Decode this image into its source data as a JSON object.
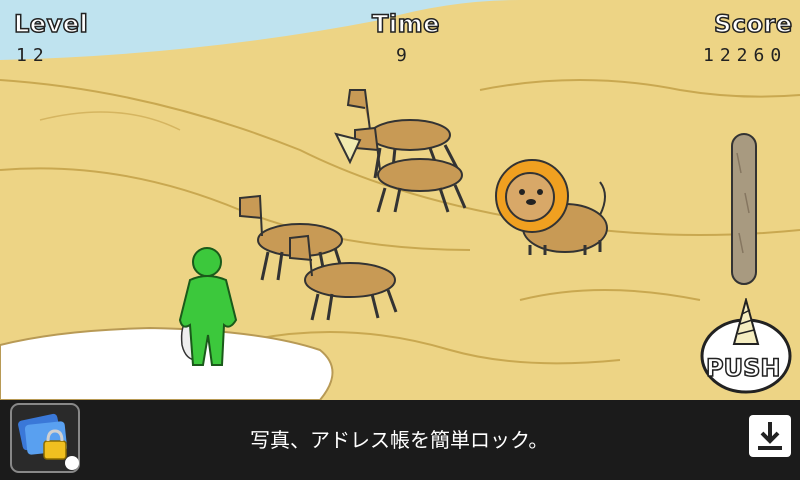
{
  "hud": {
    "level_label": "Level",
    "level_value": "12",
    "time_label": "Time",
    "time_value": "9",
    "score_label": "Score",
    "score_value": "12260"
  },
  "controls": {
    "push_label": "PUSH"
  },
  "ad": {
    "text": "写真、アドレス帳を簡単ロック。",
    "icon": "lock-app-icon",
    "download_icon": "download-icon"
  },
  "colors": {
    "sand": "#ecd280",
    "sand_dark": "#d9b860",
    "llama": "#c89a55",
    "lion_mane": "#f0a020",
    "hero": "#3cc83c",
    "ad_bg": "#1b1b1b"
  }
}
